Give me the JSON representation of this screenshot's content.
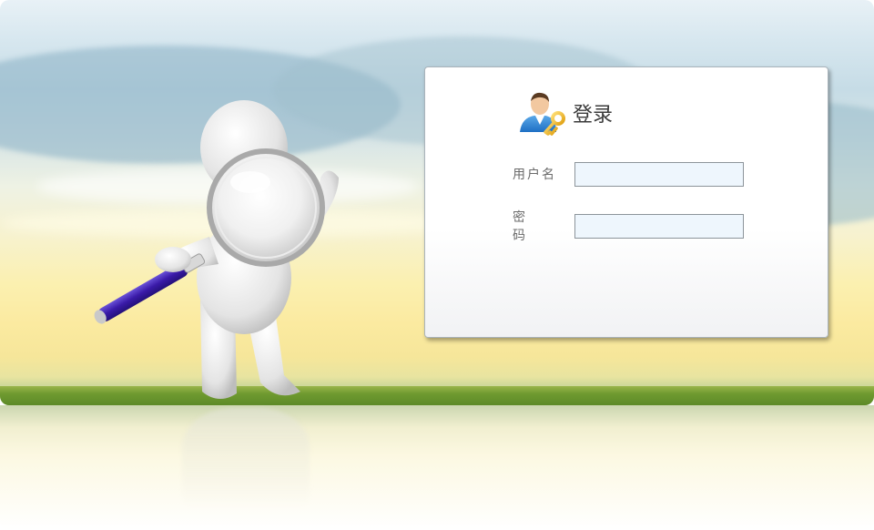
{
  "login": {
    "title": "登录",
    "header_icon": "user-key-icon",
    "fields": [
      {
        "label": "用户名",
        "value": "",
        "placeholder": "",
        "type": "text"
      },
      {
        "label": "密 码",
        "value": "",
        "placeholder": "",
        "type": "password"
      }
    ]
  },
  "background": {
    "illustration": "figure-with-magnifying-glass",
    "sky_color": "#d7e7ef",
    "horizon_color": "#fbeaa0",
    "grass_color": "#6f9a30"
  },
  "colors": {
    "input_background": "#eef6fd",
    "input_border": "#8c949a",
    "label_text": "#6b6b6b",
    "title_text": "#3b3b3b"
  }
}
